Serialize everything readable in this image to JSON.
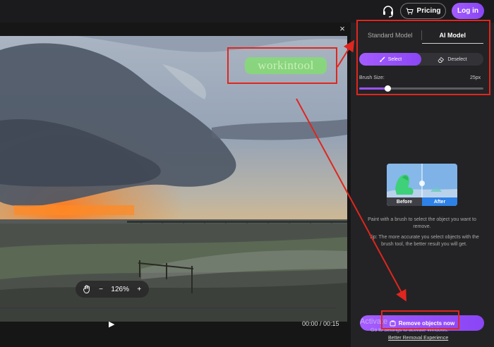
{
  "header": {
    "pricing_label": "Pricing",
    "login_label": "Log in"
  },
  "video": {
    "close_glyph": "×",
    "watermark_text": "workintool",
    "zoom_level": "126%",
    "zoom_out_glyph": "−",
    "zoom_in_glyph": "+",
    "play_glyph": "▶",
    "time_readout": "00:00 / 00:15"
  },
  "panel": {
    "tabs": [
      {
        "label": "Standard Model",
        "active": false
      },
      {
        "label": "AI Model",
        "active": true
      }
    ],
    "select_label": "Select",
    "deselect_label": "Deselect",
    "brush_label": "Brush Size:",
    "brush_value": "25px",
    "brush_fraction": 0.23,
    "before_label": "Before",
    "after_label": "After",
    "tip_main": "Paint with a brush to select the object you want to remove.",
    "tip_extra": "Tip: The more accurate you select objects with the brush tool, the better result you will get.",
    "remove_label": "Remove objects now",
    "better_link": "Better Removal Experience"
  },
  "os_overlay": {
    "activate_title": "Activate",
    "activate_sub": "Go to Settings to activate Windows."
  },
  "colors": {
    "accent": "#9b52ff",
    "after_blue": "#2e81e6",
    "annotation_red": "#e0261e",
    "watermark_green": "#85dc73"
  },
  "icons": [
    "headset-icon",
    "cart-icon",
    "close-icon",
    "hand-icon",
    "play-icon",
    "brush-icon",
    "eraser-icon",
    "remove-icon"
  ]
}
